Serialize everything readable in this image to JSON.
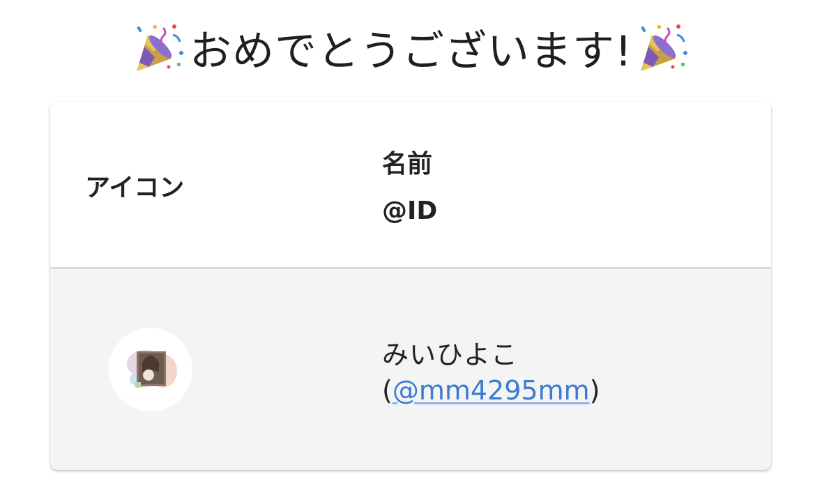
{
  "header": {
    "title": "おめでとうございます!",
    "left_emoji": "party-popper-icon",
    "right_emoji": "party-popper-icon"
  },
  "table": {
    "headers": {
      "icon": "アイコン",
      "name": "名前",
      "id": "@ID"
    },
    "rows": [
      {
        "avatar": "avatar",
        "name": "みいひよこ",
        "id_open": "(",
        "id_link": "@mm4295mm",
        "id_close": ")"
      }
    ]
  },
  "colors": {
    "link": "#3a7bd5",
    "row_bg": "#f4f4f4",
    "divider": "#dcdcdc"
  }
}
